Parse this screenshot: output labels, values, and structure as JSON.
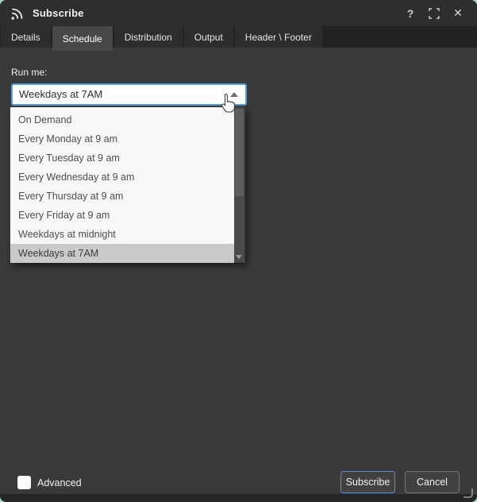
{
  "window": {
    "title": "Subscribe",
    "help_glyph": "?",
    "close_glyph": "✕"
  },
  "tabs": [
    {
      "label": "Details"
    },
    {
      "label": "Schedule",
      "active": true
    },
    {
      "label": "Distribution"
    },
    {
      "label": "Output"
    },
    {
      "label": "Header \\ Footer"
    }
  ],
  "schedule": {
    "run_me_label": "Run me:",
    "combobox_value": "Weekdays at 7AM",
    "options": [
      "On Demand",
      "Every Monday at 9 am",
      "Every Tuesday at 9 am",
      "Every Wednesday at 9 am",
      "Every Thursday at 9 am",
      "Every Friday at 9 am",
      "Weekdays at midnight",
      "Weekdays at 7AM"
    ],
    "selected_option": "Weekdays at 7AM"
  },
  "footer": {
    "advanced_label": "Advanced",
    "advanced_checked": false,
    "subscribe_label": "Subscribe",
    "cancel_label": "Cancel"
  },
  "colors": {
    "accent_blue": "#57a0dc",
    "desktop_background": "#a9d7c6",
    "popup_background": "#f7f7f7",
    "selected_row": "#cacaca",
    "dialog_background": "#3a3a3a"
  }
}
